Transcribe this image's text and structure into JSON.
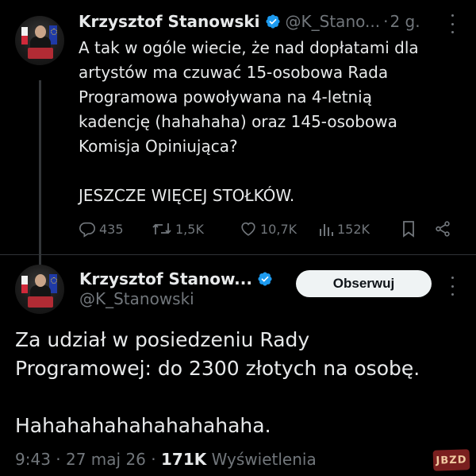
{
  "tweet1": {
    "author_name": "Krzysztof Stanowski",
    "handle": "@K_Stano...",
    "separator": "·",
    "time": "2 g.",
    "text": "A tak w ogóle wiecie, że nad dopłatami dla\nartystów ma czuwać 15-osobowa Rada\nProgramowa powoływana na 4-letnią\nkadencję (hahahaha) oraz 145-osobowa\nKomisja Opiniująca?\n\nJESZCZE WIĘCEJ STOŁKÓW.",
    "actions": {
      "replies": "435",
      "reposts": "1,5K",
      "likes": "10,7K",
      "views": "152K"
    }
  },
  "tweet2": {
    "author_name": "Krzysztof Stanow...",
    "handle": "@K_Stanowski",
    "follow_label": "Obserwuj",
    "text": "Za udział w posiedzeniu Rady\nProgramowej: do 2300 złotych na osobę.\n\nHahahahahahahahahaha.",
    "time": "9:43",
    "date": "27 maj 26",
    "views_count": "171K",
    "views_label": "Wyświetlenia"
  },
  "watermark": "JBZD",
  "colors": {
    "background": "#000000",
    "text": "#e7e9ea",
    "muted": "#71767b",
    "verified": "#1d9bf0",
    "divider": "#2f3336"
  },
  "icons": [
    "verified-badge-icon",
    "more-icon",
    "reply-icon",
    "repost-icon",
    "like-icon",
    "views-icon",
    "bookmark-icon",
    "share-icon"
  ]
}
